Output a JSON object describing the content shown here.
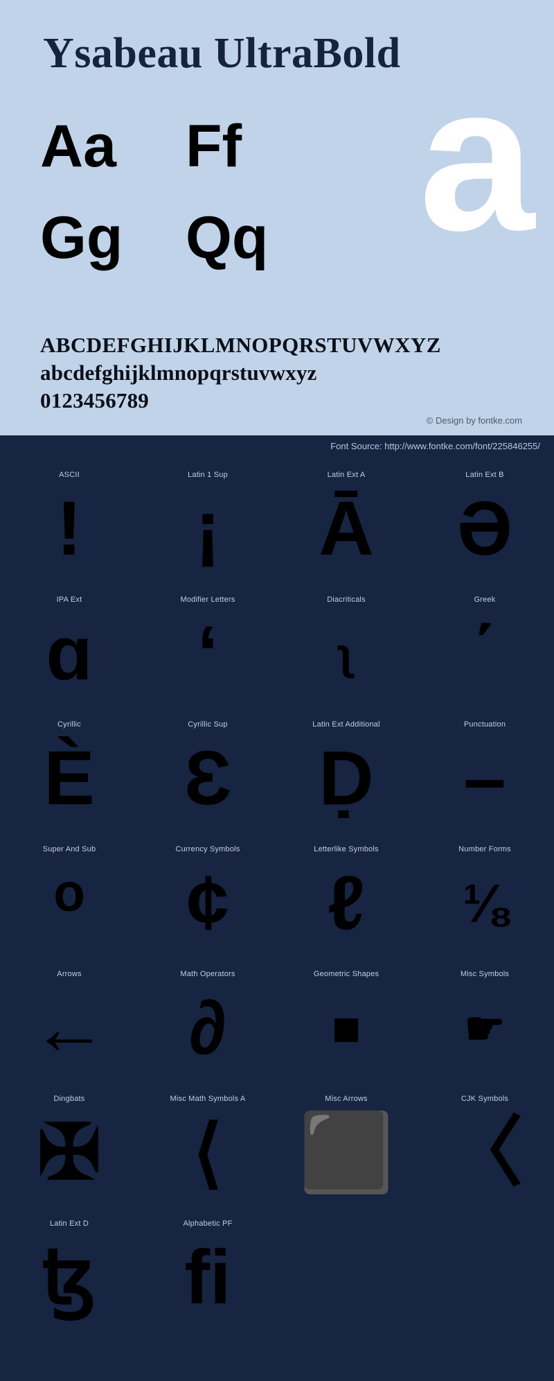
{
  "header": {
    "title": "Ysabeau UltraBold",
    "showcase_glyph": "a"
  },
  "letter_pairs": [
    {
      "glyphs": "Aa"
    },
    {
      "glyphs": "Ff"
    },
    {
      "glyphs": "Gg"
    },
    {
      "glyphs": "Qq"
    }
  ],
  "alphabet": {
    "uppercase": "ABCDEFGHIJKLMNOPQRSTUVWXYZ",
    "lowercase": "abcdefghijklmnopqrstuvwxyz",
    "digits": "0123456789"
  },
  "credit": "© Design by fontke.com",
  "font_source": "Font Source: http://www.fontke.com/font/225846255/",
  "unicode_blocks": [
    [
      {
        "label": "ASCII",
        "glyph": "!",
        "size": "xl"
      },
      {
        "label": "Latin 1 Sup",
        "glyph": "¡",
        "size": "xl"
      },
      {
        "label": "Latin Ext A",
        "glyph": "Ā",
        "size": "xl"
      },
      {
        "label": "Latin Ext B",
        "glyph": "Ə",
        "size": "xl"
      }
    ],
    [
      {
        "label": "IPA Ext",
        "glyph": "ɑ",
        "size": "xl"
      },
      {
        "label": "Modifier Letters",
        "glyph": "ʻ",
        "size": "xl"
      },
      {
        "label": "Diacriticals",
        "glyph": "ʅ",
        "size": "sm"
      },
      {
        "label": "Greek",
        "glyph": "΄",
        "size": "xl"
      }
    ],
    [
      {
        "label": "Cyrillic",
        "glyph": "È",
        "size": "xl"
      },
      {
        "label": "Cyrillic Sup",
        "glyph": "Ɛ",
        "size": "xl"
      },
      {
        "label": "Latin Ext Additional",
        "glyph": "Ḍ",
        "size": "xl"
      },
      {
        "label": "Punctuation",
        "glyph": "–",
        "size": "xl"
      }
    ],
    [
      {
        "label": "Super And Sub",
        "glyph": "ᵒ",
        "size": "xl"
      },
      {
        "label": "Currency Symbols",
        "glyph": "¢",
        "size": "xl"
      },
      {
        "label": "Letterlike Symbols",
        "glyph": "ℓ",
        "size": "xl"
      },
      {
        "label": "Number Forms",
        "glyph": "⅛",
        "size": "nar"
      }
    ],
    [
      {
        "label": "Arrows",
        "glyph": "←",
        "size": "xl"
      },
      {
        "label": "Math Operators",
        "glyph": "∂",
        "size": "xl"
      },
      {
        "label": "Geometric Shapes",
        "glyph": "■",
        "size": "sq"
      },
      {
        "label": "Misc Symbols",
        "glyph": "☛",
        "size": "hand"
      }
    ],
    [
      {
        "label": "Dingbats",
        "glyph": "✠",
        "size": "xl"
      },
      {
        "label": "Misc Math Symbols A",
        "glyph": "⟨",
        "size": "xl"
      },
      {
        "label": "Misc Arrows",
        "glyph": "⬛",
        "size": "xl"
      },
      {
        "label": "CJK Symbols",
        "glyph": "〈",
        "size": "xl"
      }
    ],
    [
      {
        "label": "Latin Ext D",
        "glyph": "ꜩ",
        "size": "xl"
      },
      {
        "label": "Alphabetic PF",
        "glyph": "ﬁ",
        "size": "xl"
      },
      {
        "label": "",
        "glyph": "",
        "size": "xl"
      },
      {
        "label": "",
        "glyph": "",
        "size": "xl"
      }
    ]
  ]
}
